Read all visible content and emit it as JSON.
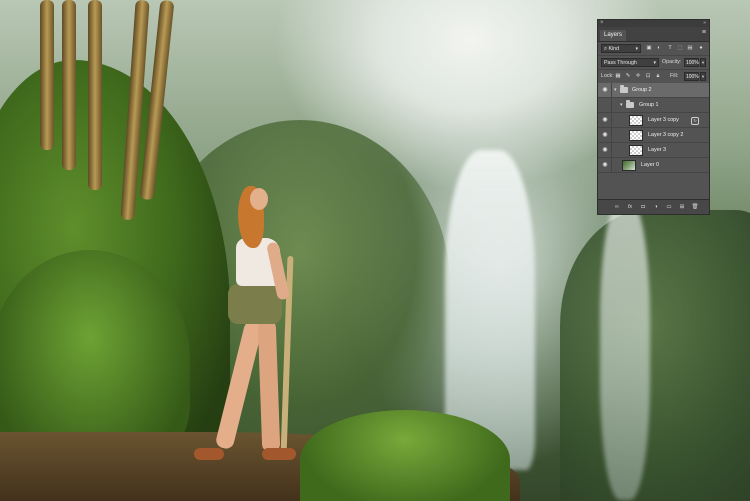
{
  "layers_panel": {
    "tab_label": "Layers",
    "close_glyph": "×",
    "collapse_glyph": "»",
    "menu_glyph": "≡",
    "filter": {
      "kind_label": "Kind",
      "search_glyph": "⌕",
      "icons": [
        "image-filter-icon",
        "adjustment-filter-icon",
        "type-filter-icon",
        "shape-filter-icon",
        "smart-object-filter-icon",
        "filter-toggle-icon"
      ]
    },
    "blend": {
      "mode": "Pass Through",
      "opacity_label": "Opacity:",
      "opacity_value": "100%"
    },
    "lock": {
      "label": "Lock:",
      "fill_label": "Fill:",
      "fill_value": "100%"
    },
    "layers": [
      {
        "name": "Group 2",
        "type": "group",
        "visible": true,
        "expanded": true,
        "selected": true
      },
      {
        "name": "Group 1",
        "type": "group",
        "visible": false,
        "expanded": true,
        "selected": false
      },
      {
        "name": "Layer 3 copy",
        "type": "pixel",
        "visible": true,
        "selected": false
      },
      {
        "name": "Layer 3 copy 2",
        "type": "pixel",
        "visible": true,
        "selected": false
      },
      {
        "name": "Layer 3",
        "type": "pixel",
        "visible": true,
        "selected": false
      },
      {
        "name": "Layer 0",
        "type": "photo",
        "visible": true,
        "selected": false
      }
    ],
    "bottom_icons": [
      "link-layers-icon",
      "fx-icon",
      "add-mask-icon",
      "adjustment-layer-icon",
      "new-group-icon",
      "new-layer-icon",
      "trash-icon"
    ],
    "fx_label": "fx"
  },
  "colors": {
    "panel_bg": "#535353",
    "selected_row": "#6a6a6a"
  }
}
